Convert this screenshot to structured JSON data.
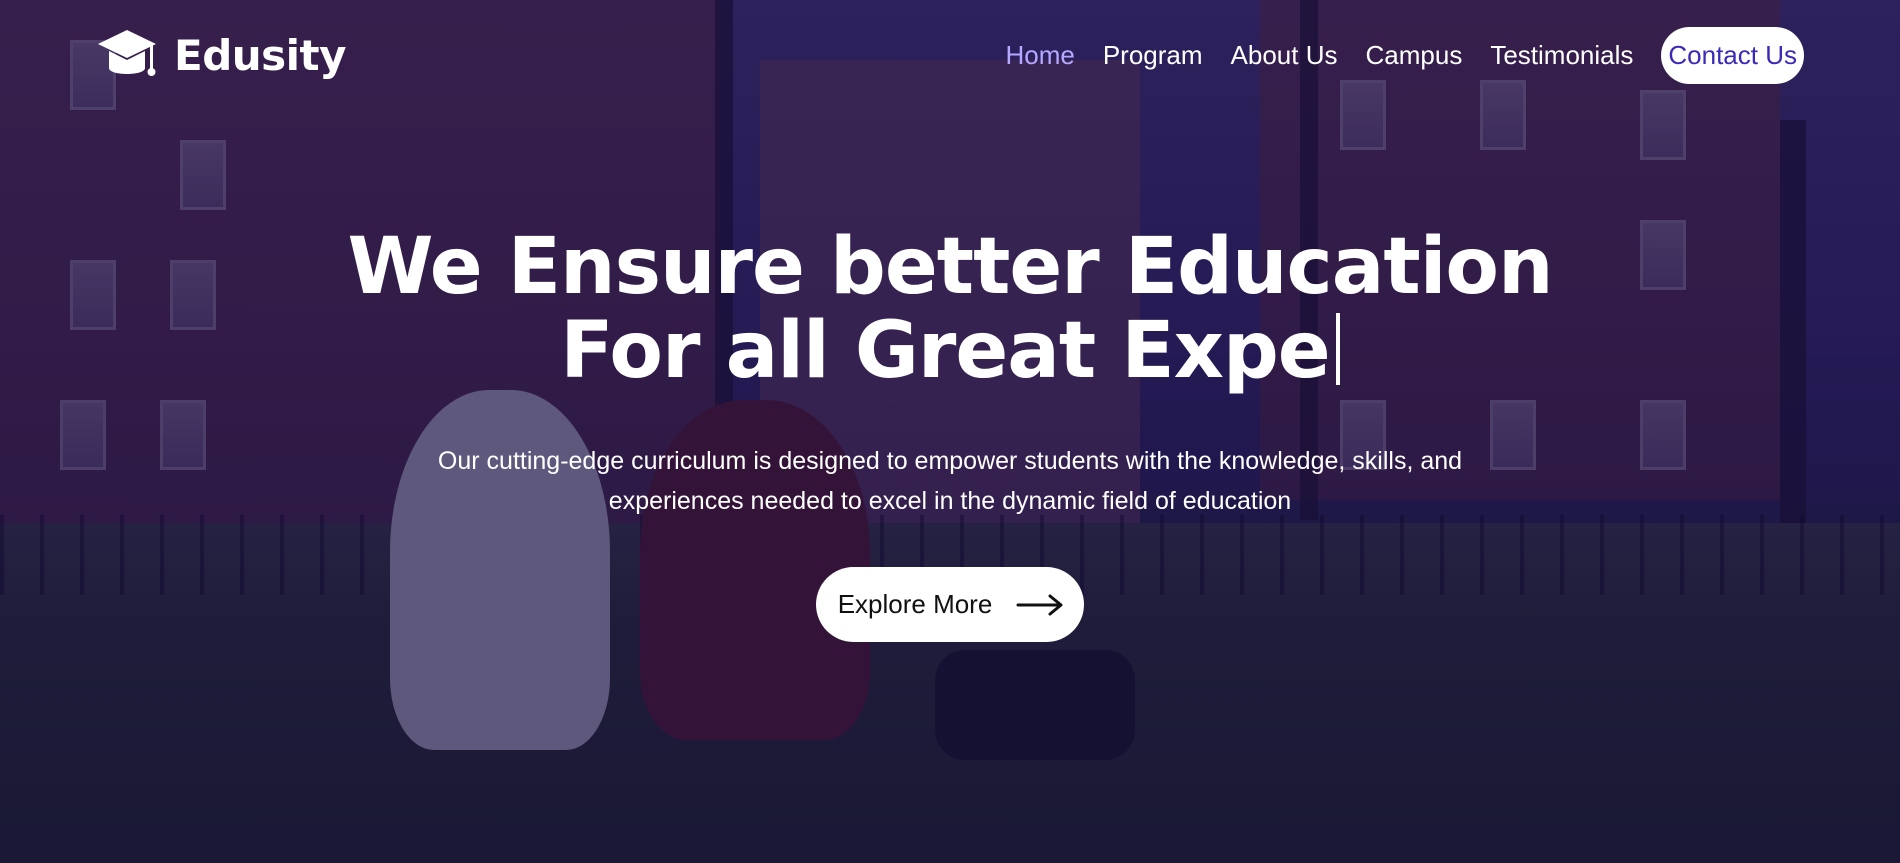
{
  "brand": {
    "name": "Edusity",
    "icon": "graduation-cap-icon"
  },
  "nav": {
    "items": [
      {
        "label": "Home",
        "active": true
      },
      {
        "label": "Program",
        "active": false
      },
      {
        "label": "About Us",
        "active": false
      },
      {
        "label": "Campus",
        "active": false
      },
      {
        "label": "Testimonials",
        "active": false
      }
    ],
    "contact_label": "Contact Us"
  },
  "hero": {
    "title_line1": "We Ensure better Education",
    "title_line2": "For all Great Expe",
    "subtitle": "Our cutting-edge curriculum is designed to empower students with the knowledge, skills, and experiences needed to excel in the dynamic field of education",
    "cta_label": "Explore More",
    "cta_icon": "arrow-right-icon"
  },
  "colors": {
    "overlay": "#08003a",
    "accent_active_nav": "#b5a8ff",
    "contact_text": "#3a2ab8",
    "text": "#ffffff"
  }
}
